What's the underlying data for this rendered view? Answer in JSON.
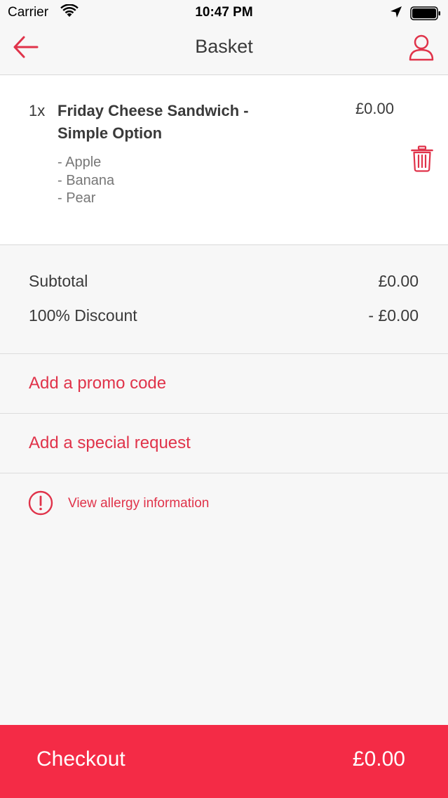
{
  "status_bar": {
    "carrier": "Carrier",
    "time": "10:47 PM"
  },
  "nav": {
    "title": "Basket",
    "back_icon": "arrow-left-icon",
    "profile_icon": "user-icon"
  },
  "basket": {
    "items": [
      {
        "quantity": "1x",
        "name": "Friday Cheese Sandwich - Simple Option",
        "price": "£0.00",
        "options": [
          "- Apple",
          "- Banana",
          "- Pear"
        ]
      }
    ]
  },
  "totals": {
    "subtotal_label": "Subtotal",
    "subtotal_value": "£0.00",
    "discount_label": "100% Discount",
    "discount_value": "- £0.00"
  },
  "actions": {
    "promo_label": "Add a promo code",
    "special_request_label": "Add a special request",
    "allergy_label": "View allergy information"
  },
  "checkout": {
    "label": "Checkout",
    "total": "£0.00"
  },
  "colors": {
    "accent": "#e0334a",
    "checkout_bg": "#f42b46"
  }
}
